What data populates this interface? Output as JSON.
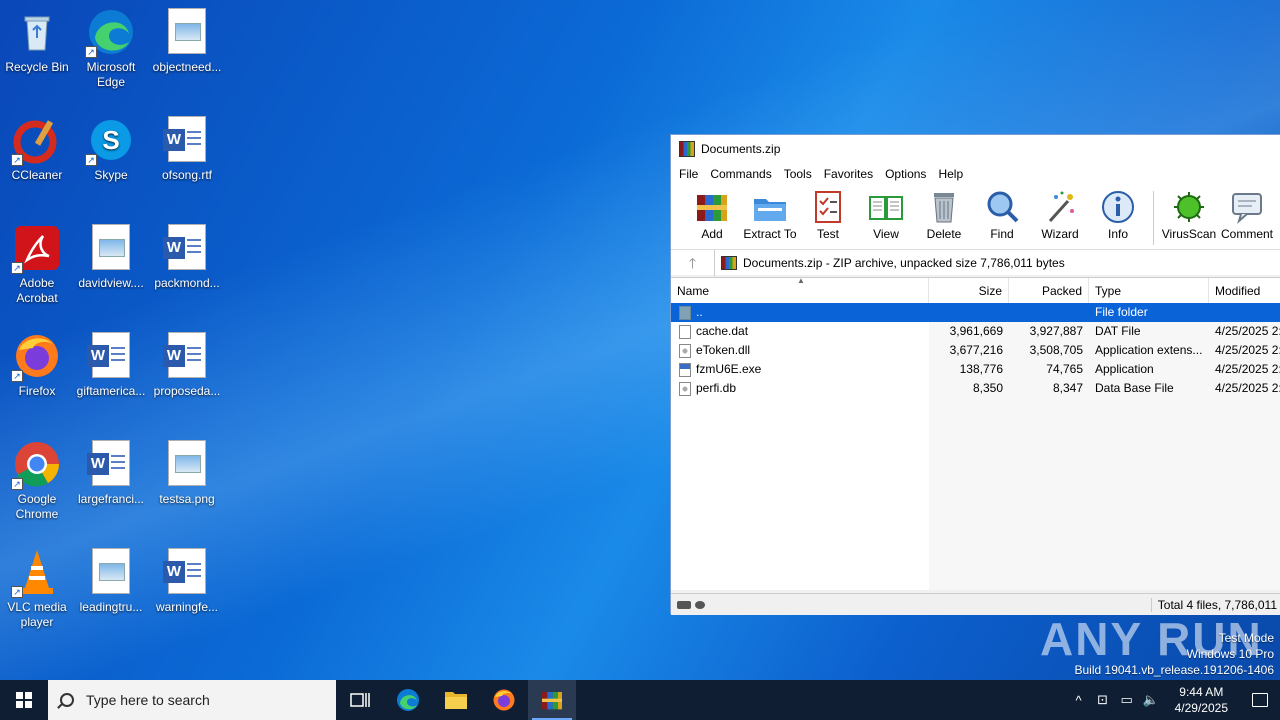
{
  "desktop": {
    "icons": [
      {
        "label": "Recycle Bin"
      },
      {
        "label": "Microsoft Edge"
      },
      {
        "label": "objectneed..."
      },
      {
        "label": "CCleaner"
      },
      {
        "label": "Skype"
      },
      {
        "label": "ofsong.rtf"
      },
      {
        "label": "Adobe Acrobat"
      },
      {
        "label": "davidview...."
      },
      {
        "label": "packmond..."
      },
      {
        "label": "Firefox"
      },
      {
        "label": "giftamerica..."
      },
      {
        "label": "proposeda..."
      },
      {
        "label": "Google Chrome"
      },
      {
        "label": "largefranci..."
      },
      {
        "label": "testsa.png"
      },
      {
        "label": "VLC media player"
      },
      {
        "label": "leadingtru..."
      },
      {
        "label": "warningfe..."
      }
    ]
  },
  "window": {
    "title": "Documents.zip",
    "menu": [
      "File",
      "Commands",
      "Tools",
      "Favorites",
      "Options",
      "Help"
    ],
    "toolbar": [
      {
        "label": "Add",
        "icon": "add-archive-icon"
      },
      {
        "label": "Extract To",
        "icon": "extract-folder-icon"
      },
      {
        "label": "Test",
        "icon": "test-checklist-icon"
      },
      {
        "label": "View",
        "icon": "book-icon"
      },
      {
        "label": "Delete",
        "icon": "trash-icon"
      },
      {
        "label": "Find",
        "icon": "magnifier-icon"
      },
      {
        "label": "Wizard",
        "icon": "magic-wand-icon"
      },
      {
        "label": "Info",
        "icon": "info-icon"
      },
      {
        "label": "VirusScan",
        "icon": "virus-icon"
      },
      {
        "label": "Comment",
        "icon": "comment-icon"
      }
    ],
    "address": "Documents.zip - ZIP archive, unpacked size 7,786,011 bytes",
    "columns": {
      "name": "Name",
      "size": "Size",
      "packed": "Packed",
      "type": "Type",
      "modified": "Modified"
    },
    "files": [
      {
        "name": "..",
        "size": "",
        "packed": "",
        "type": "File folder",
        "modified": "",
        "icon": "folder"
      },
      {
        "name": "cache.dat",
        "size": "3,961,669",
        "packed": "3,927,887",
        "type": "DAT File",
        "modified": "4/25/2025 2:",
        "icon": "file"
      },
      {
        "name": "eToken.dll",
        "size": "3,677,216",
        "packed": "3,508,705",
        "type": "Application extens...",
        "modified": "4/25/2025 2:",
        "icon": "dll"
      },
      {
        "name": "fzmU6E.exe",
        "size": "138,776",
        "packed": "74,765",
        "type": "Application",
        "modified": "4/25/2025 2:",
        "icon": "exe"
      },
      {
        "name": "perfi.db",
        "size": "8,350",
        "packed": "8,347",
        "type": "Data Base File",
        "modified": "4/25/2025 2:",
        "icon": "dll"
      }
    ],
    "status": "Total 4 files, 7,786,011"
  },
  "watermark": "ANY RUN",
  "testmode": {
    "line1": "Test Mode",
    "line2": "Windows 10 Pro",
    "line3": "Build 19041.vb_release.191206-1406"
  },
  "taskbar": {
    "search_placeholder": "Type here to search",
    "time": "9:44 AM",
    "date": "4/29/2025"
  }
}
